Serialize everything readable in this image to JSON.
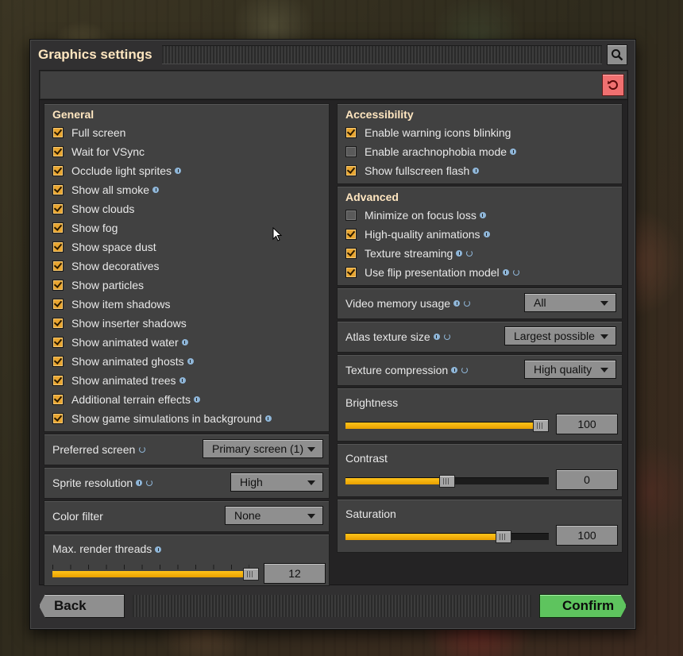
{
  "dialog": {
    "title": "Graphics settings",
    "search_icon": "search-icon",
    "reset_icon": "reset-icon"
  },
  "general": {
    "title": "General",
    "options": [
      {
        "label": "Full screen",
        "checked": true,
        "info": false,
        "sync": false
      },
      {
        "label": "Wait for VSync",
        "checked": true,
        "info": false,
        "sync": false
      },
      {
        "label": "Occlude light sprites",
        "checked": true,
        "info": true,
        "sync": false
      },
      {
        "label": "Show all smoke",
        "checked": true,
        "info": true,
        "sync": false
      },
      {
        "label": "Show clouds",
        "checked": true,
        "info": false,
        "sync": false
      },
      {
        "label": "Show fog",
        "checked": true,
        "info": false,
        "sync": false
      },
      {
        "label": "Show space dust",
        "checked": true,
        "info": false,
        "sync": false
      },
      {
        "label": "Show decoratives",
        "checked": true,
        "info": false,
        "sync": false
      },
      {
        "label": "Show particles",
        "checked": true,
        "info": false,
        "sync": false
      },
      {
        "label": "Show item shadows",
        "checked": true,
        "info": false,
        "sync": false
      },
      {
        "label": "Show inserter shadows",
        "checked": true,
        "info": false,
        "sync": false
      },
      {
        "label": "Show animated water",
        "checked": true,
        "info": true,
        "sync": false
      },
      {
        "label": "Show animated ghosts",
        "checked": true,
        "info": true,
        "sync": false
      },
      {
        "label": "Show animated trees",
        "checked": true,
        "info": true,
        "sync": false
      },
      {
        "label": "Additional terrain effects",
        "checked": true,
        "info": true,
        "sync": false
      },
      {
        "label": "Show game simulations in background",
        "checked": true,
        "info": true,
        "sync": false
      }
    ]
  },
  "left_settings": [
    {
      "label": "Preferred screen",
      "info": false,
      "sync": true,
      "value": "Primary screen (1)",
      "name": "preferred-screen"
    },
    {
      "label": "Sprite resolution",
      "info": true,
      "sync": true,
      "value": "High",
      "name": "sprite-resolution"
    },
    {
      "label": "Color filter",
      "info": false,
      "sync": false,
      "value": "None",
      "name": "color-filter"
    }
  ],
  "render_threads": {
    "label": "Max. render threads",
    "value": "12",
    "level": 1.0
  },
  "accessibility": {
    "title": "Accessibility",
    "options": [
      {
        "label": "Enable warning icons blinking",
        "checked": true,
        "info": false,
        "sync": false
      },
      {
        "label": "Enable arachnophobia mode",
        "checked": false,
        "info": true,
        "sync": false
      },
      {
        "label": "Show fullscreen flash",
        "checked": true,
        "info": true,
        "sync": false
      }
    ]
  },
  "advanced": {
    "title": "Advanced",
    "options": [
      {
        "label": "Minimize on focus loss",
        "checked": false,
        "info": true,
        "sync": false
      },
      {
        "label": "High-quality animations",
        "checked": true,
        "info": true,
        "sync": false
      },
      {
        "label": "Texture streaming",
        "checked": true,
        "info": true,
        "sync": true
      },
      {
        "label": "Use flip presentation model",
        "checked": true,
        "info": true,
        "sync": true
      }
    ]
  },
  "right_settings": [
    {
      "label": "Video memory usage",
      "info": true,
      "sync": true,
      "value": "All",
      "name": "video-memory-usage"
    },
    {
      "label": "Atlas texture size",
      "info": true,
      "sync": true,
      "value": "Largest possible",
      "name": "atlas-texture-size"
    },
    {
      "label": "Texture compression",
      "info": true,
      "sync": true,
      "value": "High quality",
      "name": "texture-compression"
    }
  ],
  "sliders": [
    {
      "label": "Brightness",
      "value": "100",
      "level": 1.0,
      "name": "brightness"
    },
    {
      "label": "Contrast",
      "value": "0",
      "level": 0.5,
      "name": "contrast"
    },
    {
      "label": "Saturation",
      "value": "100",
      "level": 0.8,
      "name": "saturation"
    }
  ],
  "footer": {
    "back_label": "Back",
    "confirm_label": "Confirm"
  },
  "colors": {
    "accent": "#e8a530",
    "slider_fill": "#ffc31a",
    "confirm": "#5ec45e",
    "reset": "#f07070",
    "title": "#ffe6c0"
  }
}
